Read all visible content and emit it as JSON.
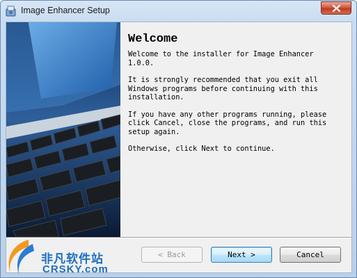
{
  "window": {
    "title": "Image Enhancer Setup"
  },
  "content": {
    "heading": "Welcome",
    "paragraphs": [
      "Welcome to the installer for Image Enhancer\n1.0.0.",
      "It is strongly recommended that you exit all\nWindows programs before continuing with this\ninstallation.",
      "If you have any other programs running, please\nclick Cancel, close the programs, and run this\nsetup again.",
      "Otherwise, click Next to continue."
    ]
  },
  "buttons": {
    "back": "< Back",
    "next": "Next >",
    "cancel": "Cancel",
    "back_enabled": false
  },
  "watermark": {
    "cn": "非凡软件站",
    "en": "CRSKY.com"
  },
  "icons": {
    "app": "installer-icon",
    "close": "close-icon"
  }
}
